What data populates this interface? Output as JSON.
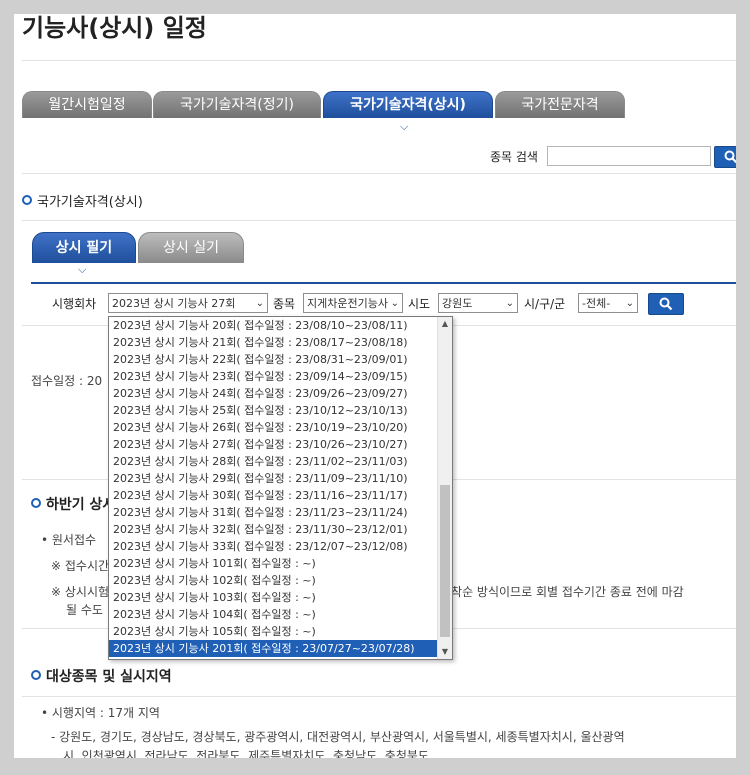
{
  "page": {
    "title": "기능사(상시) 일정"
  },
  "tabs": [
    {
      "label": "월간시험일정",
      "active": false
    },
    {
      "label": "국가기술자격(정기)",
      "active": false
    },
    {
      "label": "국가기술자격(상시)",
      "active": true
    },
    {
      "label": "국가전문자격",
      "active": false
    }
  ],
  "search": {
    "label": "종목 검색",
    "value": ""
  },
  "section": {
    "title": "국가기술자격(상시)"
  },
  "subtabs": [
    {
      "label": "상시 필기",
      "active": true
    },
    {
      "label": "상시 실기",
      "active": false
    }
  ],
  "filters": {
    "round_label": "시행회차",
    "round_value": "2023년 상시 기능사 27회",
    "item_label": "종목",
    "item_value": "지게차운전기능사",
    "sido_label": "시도",
    "sido_value": "강원도",
    "gu_label": "시/구/군",
    "gu_value": "-전체-"
  },
  "dropdown_options": [
    "2023년 상시 기능사 20회( 접수일정 : 23/08/10~23/08/11)",
    "2023년 상시 기능사 21회( 접수일정 : 23/08/17~23/08/18)",
    "2023년 상시 기능사 22회( 접수일정 : 23/08/31~23/09/01)",
    "2023년 상시 기능사 23회( 접수일정 : 23/09/14~23/09/15)",
    "2023년 상시 기능사 24회( 접수일정 : 23/09/26~23/09/27)",
    "2023년 상시 기능사 25회( 접수일정 : 23/10/12~23/10/13)",
    "2023년 상시 기능사 26회( 접수일정 : 23/10/19~23/10/20)",
    "2023년 상시 기능사 27회( 접수일정 : 23/10/26~23/10/27)",
    "2023년 상시 기능사 28회( 접수일정 : 23/11/02~23/11/03)",
    "2023년 상시 기능사 29회( 접수일정 : 23/11/09~23/11/10)",
    "2023년 상시 기능사 30회( 접수일정 : 23/11/16~23/11/17)",
    "2023년 상시 기능사 31회( 접수일정 : 23/11/23~23/11/24)",
    "2023년 상시 기능사 32회( 접수일정 : 23/11/30~23/12/01)",
    "2023년 상시 기능사 33회( 접수일정 : 23/12/07~23/12/08)",
    "2023년 상시 기능사 101회( 접수일정 : ~)",
    "2023년 상시 기능사 102회( 접수일정 : ~)",
    "2023년 상시 기능사 103회( 접수일정 : ~)",
    "2023년 상시 기능사 104회( 접수일정 : ~)",
    "2023년 상시 기능사 105회( 접수일정 : ~)",
    "2023년 상시 기능사 201회( 접수일정 : 23/07/27~23/07/28)"
  ],
  "selected_option_index": 19,
  "content": {
    "receipt_label": "접수일정 : 20",
    "half_title": "하반기 상시",
    "bullet1": "• 원서접수",
    "note1": "※ 접수시간",
    "note2a": "※ 상시시험",
    "note2b": "선착순 방식이므로 회별 접수기간 종료 전에 마감",
    "note2c": "될 수도",
    "target_title": "대상종목 및 실시지역",
    "region_bullet": "• 시행지역 : 17개 지역",
    "regions_line1": "- 강원도, 경기도, 경상남도, 경상북도, 광주광역시, 대전광역시, 부산광역시, 서울특별시, 세종특별자치시, 울산광역",
    "regions_line2": "시, 인천광역시, 전라남도, 전라북도, 제주특별자치도, 충청남도, 충청북도"
  },
  "icons": {
    "search": "search-icon",
    "caret": "chevron-down-icon"
  },
  "colors": {
    "accent": "#1f5fb5",
    "tab_inactive": "#7f7f7f"
  }
}
